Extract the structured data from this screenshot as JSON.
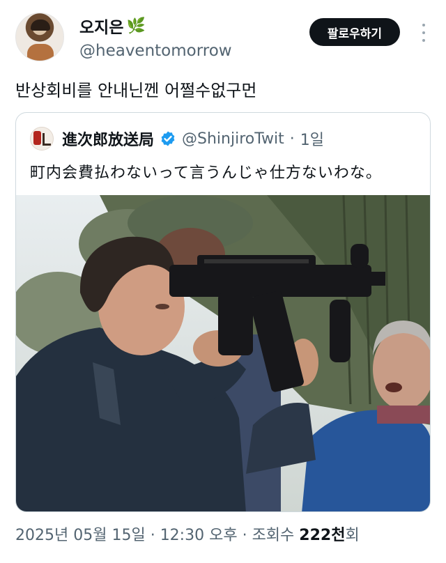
{
  "author": {
    "name": "오지은",
    "name_emoji": "🌿",
    "handle": "@heaventomorrow",
    "follow_label": "팔로우하기",
    "more_icon": "more-vertical-icon"
  },
  "tweet": {
    "text": "반상회비를 안내닌껜 어쩔수없구먼"
  },
  "quote": {
    "name": "進次郎放送局",
    "handle": "@ShinjiroTwit",
    "separator": "·",
    "time": "1일",
    "text": "町内会費払わないって言うんじゃ仕方ないわな。",
    "verified_color": "#1d9bf0",
    "image_description": "photo"
  },
  "meta": {
    "date": "2025년 05월 15일",
    "dot": "·",
    "time": "12:30 오후",
    "views_label": "조회수",
    "views_count": "222천",
    "views_suffix": "회"
  }
}
